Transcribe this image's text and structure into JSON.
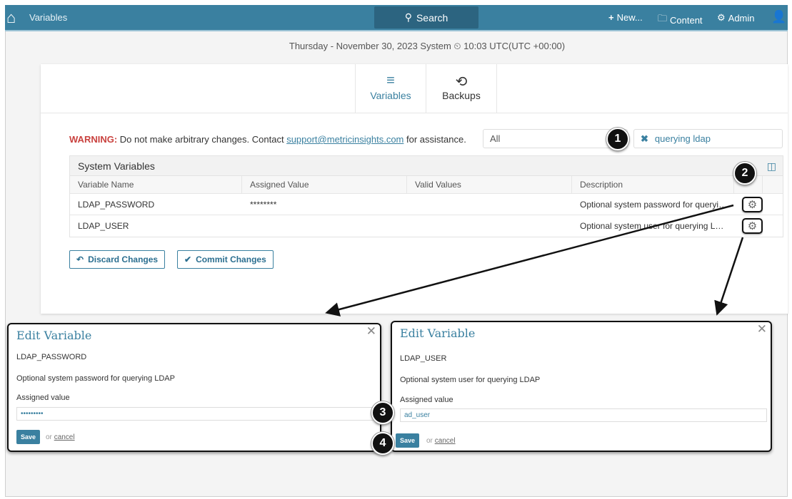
{
  "topbar": {
    "title": "Variables",
    "search_label": "Search",
    "new_label": "New...",
    "content_label": "Content",
    "admin_label": "Admin"
  },
  "datetime": "Thursday - November 30, 2023 System ⏲ 10:03 UTC(UTC +00:00)",
  "tabs": [
    {
      "label": "Variables",
      "active": true
    },
    {
      "label": "Backups",
      "active": false
    }
  ],
  "warning": {
    "prefix": "WARNING:",
    "text": " Do not make arbitrary changes. Contact ",
    "email": "support@metricinsights.com",
    "suffix": " for assistance."
  },
  "filter": {
    "value": "All"
  },
  "search": {
    "value": "querying ldap"
  },
  "table": {
    "caption": "System Variables",
    "columns": [
      "Variable Name",
      "Assigned Value",
      "Valid Values",
      "Description"
    ],
    "rows": [
      {
        "name": "LDAP_PASSWORD",
        "value": "********",
        "valid": "",
        "description": "Optional system password for querying LDAP"
      },
      {
        "name": "LDAP_USER",
        "value": "",
        "valid": "",
        "description": "Optional system user for querying LDAP"
      }
    ]
  },
  "buttons": {
    "discard": "Discard Changes",
    "commit": "Commit Changes"
  },
  "dialogs": [
    {
      "title": "Edit Variable",
      "name": "LDAP_PASSWORD",
      "description": "Optional system password for querying LDAP",
      "label": "Assigned value",
      "value": "•••••••••",
      "save": "Save",
      "or": "or",
      "cancel": "cancel"
    },
    {
      "title": "Edit Variable",
      "name": "LDAP_USER",
      "description": "Optional system user for querying LDAP",
      "label": "Assigned value",
      "value": "ad_user",
      "save": "Save",
      "or": "or",
      "cancel": "cancel"
    }
  ],
  "callouts": [
    "1",
    "2",
    "3",
    "4"
  ],
  "colors": {
    "brand": "#3a80a0",
    "warning": "#c9423f"
  }
}
